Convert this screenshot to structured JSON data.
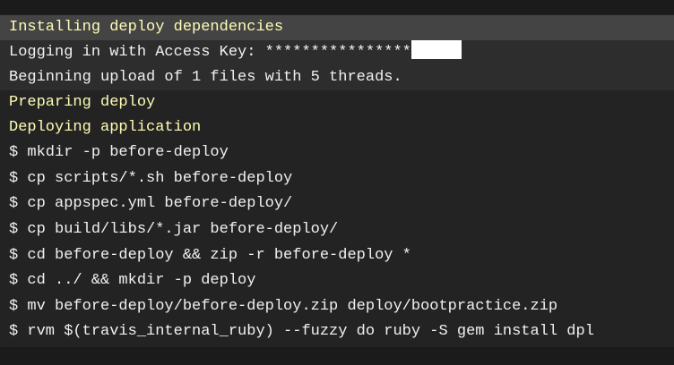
{
  "terminal": {
    "colors": {
      "background": "#232323",
      "fold_header_background": "#444444",
      "fold_body_background": "#2d2d2d",
      "text": "#f1f1f1",
      "section_text": "#fffdb5",
      "redaction": "#ffffff"
    },
    "lines": [
      "Installing deploy dependencies",
      "Logging in with Access Key: ****************",
      "Beginning upload of 1 files with 5 threads.",
      "Preparing deploy",
      "Deploying application",
      "$ mkdir -p before-deploy",
      "$ cp scripts/*.sh before-deploy",
      "$ cp appspec.yml before-deploy/",
      "$ cp build/libs/*.jar before-deploy/",
      "$ cd before-deploy && zip -r before-deploy *",
      "$ cd ../ && mkdir -p deploy",
      "$ mv before-deploy/before-deploy.zip deploy/bootpractice.zip",
      "$ rvm $(travis_internal_ruby) --fuzzy do ruby -S gem install dpl"
    ]
  }
}
